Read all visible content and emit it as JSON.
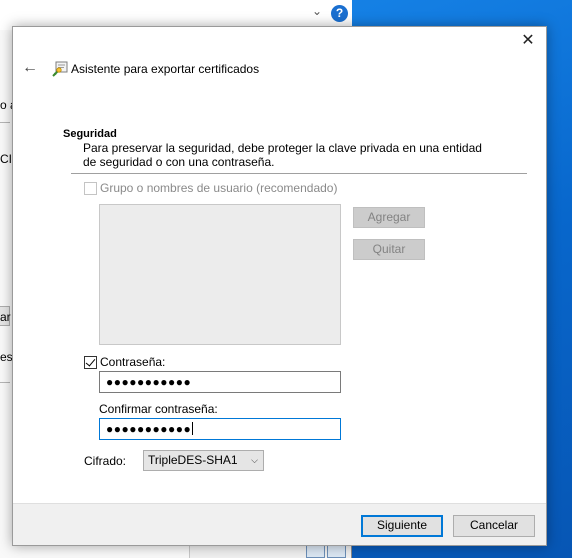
{
  "background": {
    "fragments": [
      "o a",
      "CI",
      "ar",
      "es"
    ],
    "help_label": "?"
  },
  "dialog": {
    "title": "Asistente para exportar certificados",
    "close_glyph": "✕",
    "back_glyph": "←",
    "section": {
      "title": "Seguridad",
      "description": "Para preservar la seguridad, debe proteger la clave privada en una entidad de seguridad o con una contraseña."
    },
    "group_option": {
      "label": "Grupo o nombres de usuario (recomendado)",
      "checked": false,
      "enabled": false
    },
    "buttons": {
      "add": "Agregar",
      "remove": "Quitar",
      "next": "Siguiente",
      "cancel": "Cancelar"
    },
    "password_option": {
      "label": "Contraseña:",
      "checked": true
    },
    "password": {
      "value": "●●●●●●●●●●●"
    },
    "confirm": {
      "label": "Confirmar contraseña:",
      "value": "●●●●●●●●●●●"
    },
    "encryption": {
      "label": "Cifrado:",
      "selected": "TripleDES-SHA1"
    }
  },
  "colors": {
    "accent": "#0078d7",
    "desktop": "#0a74d6",
    "disabled_text": "#838383"
  },
  "icons": {
    "back": "back-arrow-icon",
    "wizard": "certificate-wizard-icon",
    "close": "close-icon",
    "dropdown": "chevron-down-icon"
  }
}
